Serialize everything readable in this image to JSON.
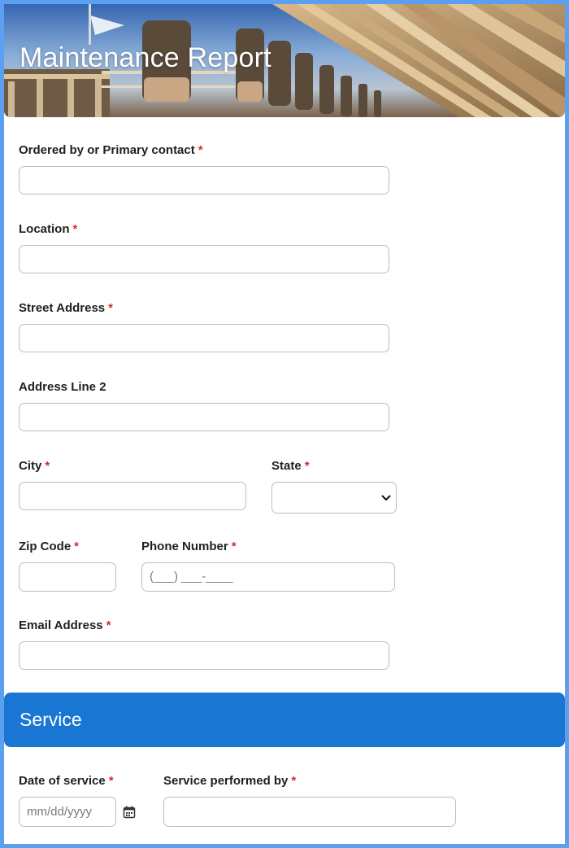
{
  "header": {
    "title": "Maintenance Report"
  },
  "form": {
    "required_marker": "*",
    "fields": {
      "ordered_by": {
        "label": "Ordered by or Primary contact",
        "value": ""
      },
      "location": {
        "label": "Location",
        "value": ""
      },
      "street_address": {
        "label": "Street Address",
        "value": ""
      },
      "address_line_2": {
        "label": "Address Line 2",
        "value": ""
      },
      "city": {
        "label": "City",
        "value": ""
      },
      "state": {
        "label": "State",
        "selected": ""
      },
      "zip_code": {
        "label": "Zip Code",
        "value": ""
      },
      "phone_number": {
        "label": "Phone Number",
        "placeholder": "(___) ___-____"
      },
      "email_address": {
        "label": "Email Address",
        "value": ""
      }
    }
  },
  "service_section": {
    "title": "Service",
    "fields": {
      "date_of_service": {
        "label": "Date of service",
        "placeholder": "mm/dd/yyyy"
      },
      "service_performed_by": {
        "label": "Service performed by",
        "value": ""
      }
    }
  },
  "icons": {
    "select_chevron": "chevron-down-icon",
    "date_picker": "calendar-icon"
  },
  "colors": {
    "page_border": "#5b9ff0",
    "section_band": "#1976d2",
    "required": "#d42c2c"
  }
}
